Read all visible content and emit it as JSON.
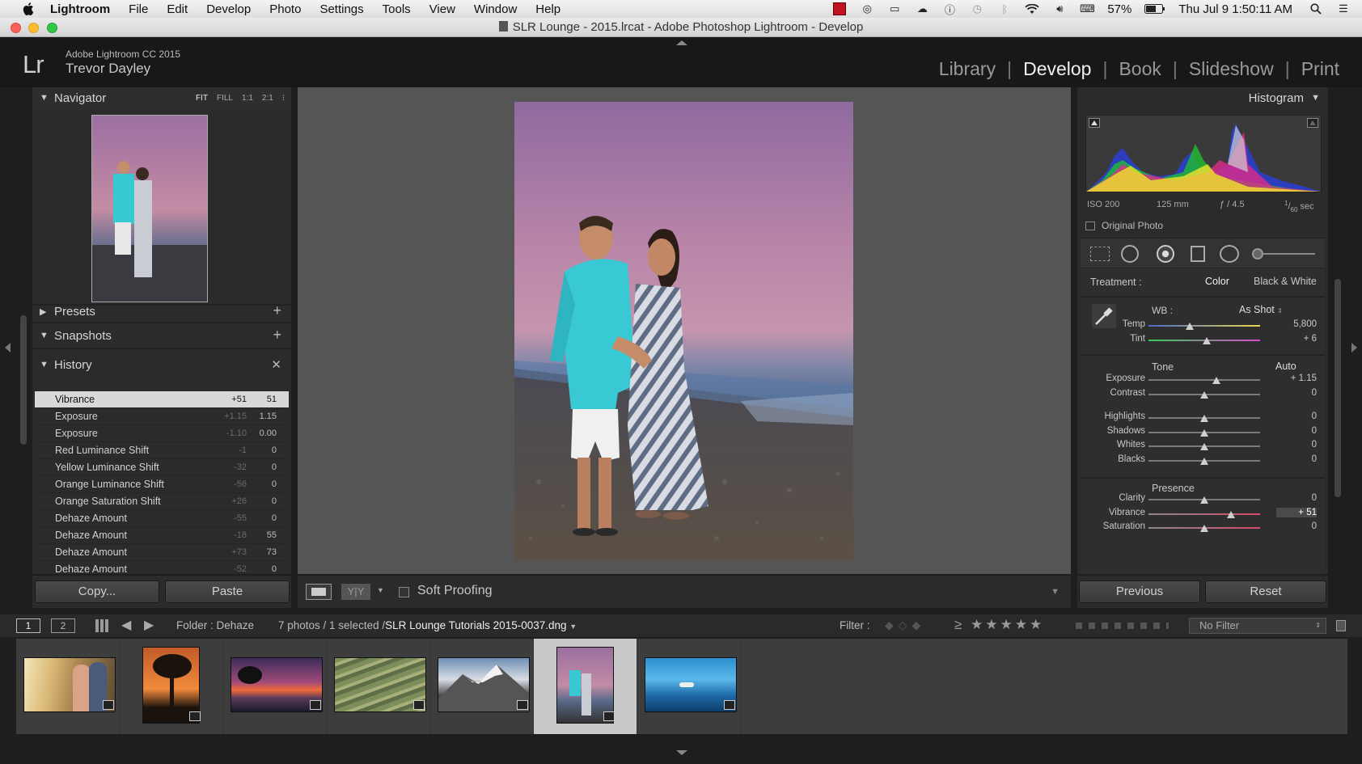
{
  "menubar": {
    "app": "Lightroom",
    "items": [
      "File",
      "Edit",
      "Develop",
      "Photo",
      "Settings",
      "Tools",
      "View",
      "Window",
      "Help"
    ],
    "battery": "57%",
    "clock": "Thu Jul 9  1:50:11 AM",
    "icons": [
      "apple-icon",
      "flag-icon",
      "airplay-icon",
      "display-icon",
      "cloud-icon",
      "info-icon",
      "time-machine-icon",
      "bluetooth-icon",
      "wifi-icon",
      "volume-icon",
      "input-icon",
      "battery-icon",
      "spotlight-icon",
      "notification-icon"
    ]
  },
  "window": {
    "title": "SLR Lounge - 2015.lrcat - Adobe Photoshop Lightroom - Develop"
  },
  "identity": {
    "logo": "Lr",
    "version": "Adobe Lightroom CC 2015",
    "user": "Trevor Dayley",
    "modules": [
      "Library",
      "Develop",
      "Book",
      "Slideshow",
      "Print"
    ],
    "active_module": "Develop"
  },
  "left": {
    "navigator": {
      "title": "Navigator",
      "sizes": [
        "FIT",
        "FILL",
        "1:1",
        "2:1"
      ]
    },
    "presets": {
      "title": "Presets"
    },
    "snapshots": {
      "title": "Snapshots"
    },
    "history": {
      "title": "History",
      "items": [
        {
          "label": "Vibrance",
          "before": "+51",
          "after": "51"
        },
        {
          "label": "Exposure",
          "before": "+1.15",
          "after": "1.15"
        },
        {
          "label": "Exposure",
          "before": "-1.10",
          "after": "0.00"
        },
        {
          "label": "Red Luminance Shift",
          "before": "-1",
          "after": "0"
        },
        {
          "label": "Yellow Luminance Shift",
          "before": "-32",
          "after": "0"
        },
        {
          "label": "Orange Luminance Shift",
          "before": "-56",
          "after": "0"
        },
        {
          "label": "Orange Saturation Shift",
          "before": "+26",
          "after": "0"
        },
        {
          "label": "Dehaze Amount",
          "before": "-55",
          "after": "0"
        },
        {
          "label": "Dehaze Amount",
          "before": "-18",
          "after": "55"
        },
        {
          "label": "Dehaze Amount",
          "before": "+73",
          "after": "73"
        },
        {
          "label": "Dehaze Amount",
          "before": "-52",
          "after": "0"
        }
      ]
    },
    "copy_label": "Copy...",
    "paste_label": "Paste"
  },
  "toolbar": {
    "soft_proofing": "Soft Proofing"
  },
  "right": {
    "histogram_title": "Histogram",
    "exif": {
      "iso": "ISO 200",
      "focal": "125 mm",
      "aperture": "ƒ / 4.5",
      "shutter_num": "1",
      "shutter_den": "60",
      "shutter_unit": "sec"
    },
    "original_photo": "Original Photo",
    "treatment_label": "Treatment :",
    "treatment_color": "Color",
    "treatment_bw": "Black & White",
    "wb_label": "WB :",
    "wb_value": "As Shot",
    "tone_label": "Tone",
    "auto_label": "Auto",
    "presence_label": "Presence",
    "sliders": [
      {
        "name": "Temp",
        "value": "5,800",
        "pos": 0.37,
        "group": "wb"
      },
      {
        "name": "Tint",
        "value": "+ 6",
        "pos": 0.52,
        "group": "wb"
      },
      {
        "name": "Exposure",
        "value": "+ 1.15",
        "pos": 0.61,
        "group": "tone"
      },
      {
        "name": "Contrast",
        "value": "0",
        "pos": 0.5,
        "group": "tone"
      },
      {
        "name": "Highlights",
        "value": "0",
        "pos": 0.5,
        "group": "tone2"
      },
      {
        "name": "Shadows",
        "value": "0",
        "pos": 0.5,
        "group": "tone2"
      },
      {
        "name": "Whites",
        "value": "0",
        "pos": 0.5,
        "group": "tone2"
      },
      {
        "name": "Blacks",
        "value": "0",
        "pos": 0.5,
        "group": "tone2"
      },
      {
        "name": "Clarity",
        "value": "0",
        "pos": 0.5,
        "group": "presence"
      },
      {
        "name": "Vibrance",
        "value": "+ 51",
        "pos": 0.74,
        "group": "presence"
      },
      {
        "name": "Saturation",
        "value": "0",
        "pos": 0.5,
        "group": "presence"
      }
    ],
    "previous_label": "Previous",
    "reset_label": "Reset"
  },
  "filmbar": {
    "page1": "1",
    "page2": "2",
    "folder": "Folder : Dehaze",
    "count": "7 photos / 1 selected /",
    "file": "SLR Lounge Tutorials 2015-0037.dng",
    "filter_label": "Filter :",
    "filter_value": "No Filter"
  },
  "filmstrip": {
    "thumbs": [
      {
        "name": "couple-sunset"
      },
      {
        "name": "tree-sunset"
      },
      {
        "name": "purple-sunset"
      },
      {
        "name": "green-water"
      },
      {
        "name": "mountain"
      },
      {
        "name": "couple-beach"
      },
      {
        "name": "blue-ocean"
      }
    ],
    "selected_index": 5
  }
}
